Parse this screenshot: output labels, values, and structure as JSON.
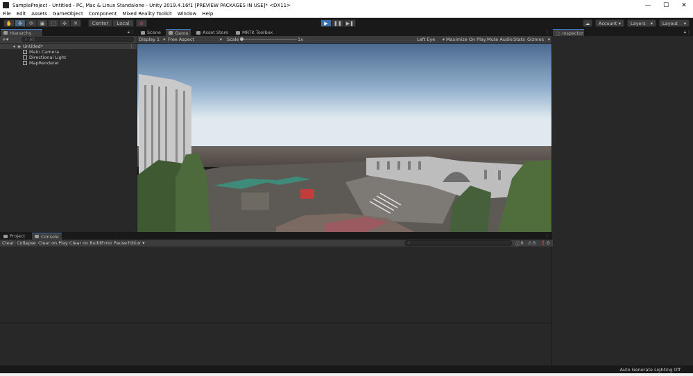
{
  "window": {
    "title": "SampleProject - Untitled - PC, Mac & Linux Standalone - Unity 2019.4.16f1 [PREVIEW PACKAGES IN USE]* <DX11>",
    "minimize": "—",
    "maximize": "☐",
    "close": "✕"
  },
  "menu": [
    "File",
    "Edit",
    "Assets",
    "GameObject",
    "Component",
    "Mixed Reality Toolkit",
    "Window",
    "Help"
  ],
  "toolbar": {
    "tools": [
      "✋",
      "✥",
      "⟳",
      "▣",
      "⬚",
      "✣",
      "✕"
    ],
    "pivot": "Center",
    "space": "Local",
    "play": "▶",
    "pause": "❚❚",
    "step": "▶❚",
    "account": "Account",
    "layers": "Layers",
    "layout": "Layout"
  },
  "hierarchy": {
    "tab": "Hierarchy",
    "add": "+▾",
    "search_placeholder": "All",
    "scene": "Untitled*",
    "items": [
      "Main Camera",
      "Directional Light",
      "MapRenderer"
    ]
  },
  "center_tabs": [
    "Scene",
    "Game",
    "Asset Store",
    "MRTK Toolbox"
  ],
  "game_toolbar": {
    "display": "Display 1",
    "aspect": "Free Aspect",
    "scale_label": "Scale",
    "scale_value": "1x",
    "scale_fraction": 0.0,
    "eye": "Left Eye",
    "maximize": "Maximize On Play",
    "mute": "Mute Audio",
    "stats": "Stats",
    "gizmos": "Gizmos"
  },
  "inspector": {
    "tab": "Inspector"
  },
  "bottom_tabs": [
    "Project",
    "Console"
  ],
  "console": {
    "buttons": [
      "Clear",
      "Collapse",
      "Clear on Play",
      "Clear on Build",
      "Error Pause",
      "Editor ▾"
    ],
    "counts": {
      "logs": "0",
      "warnings": "0",
      "errors": "0"
    }
  },
  "status": {
    "message": "Auto Generate Lighting Off"
  },
  "colors": {
    "accent": "#3a72b0",
    "panel": "#282828",
    "toolbar": "#3c3c3c",
    "background": "#191919"
  }
}
